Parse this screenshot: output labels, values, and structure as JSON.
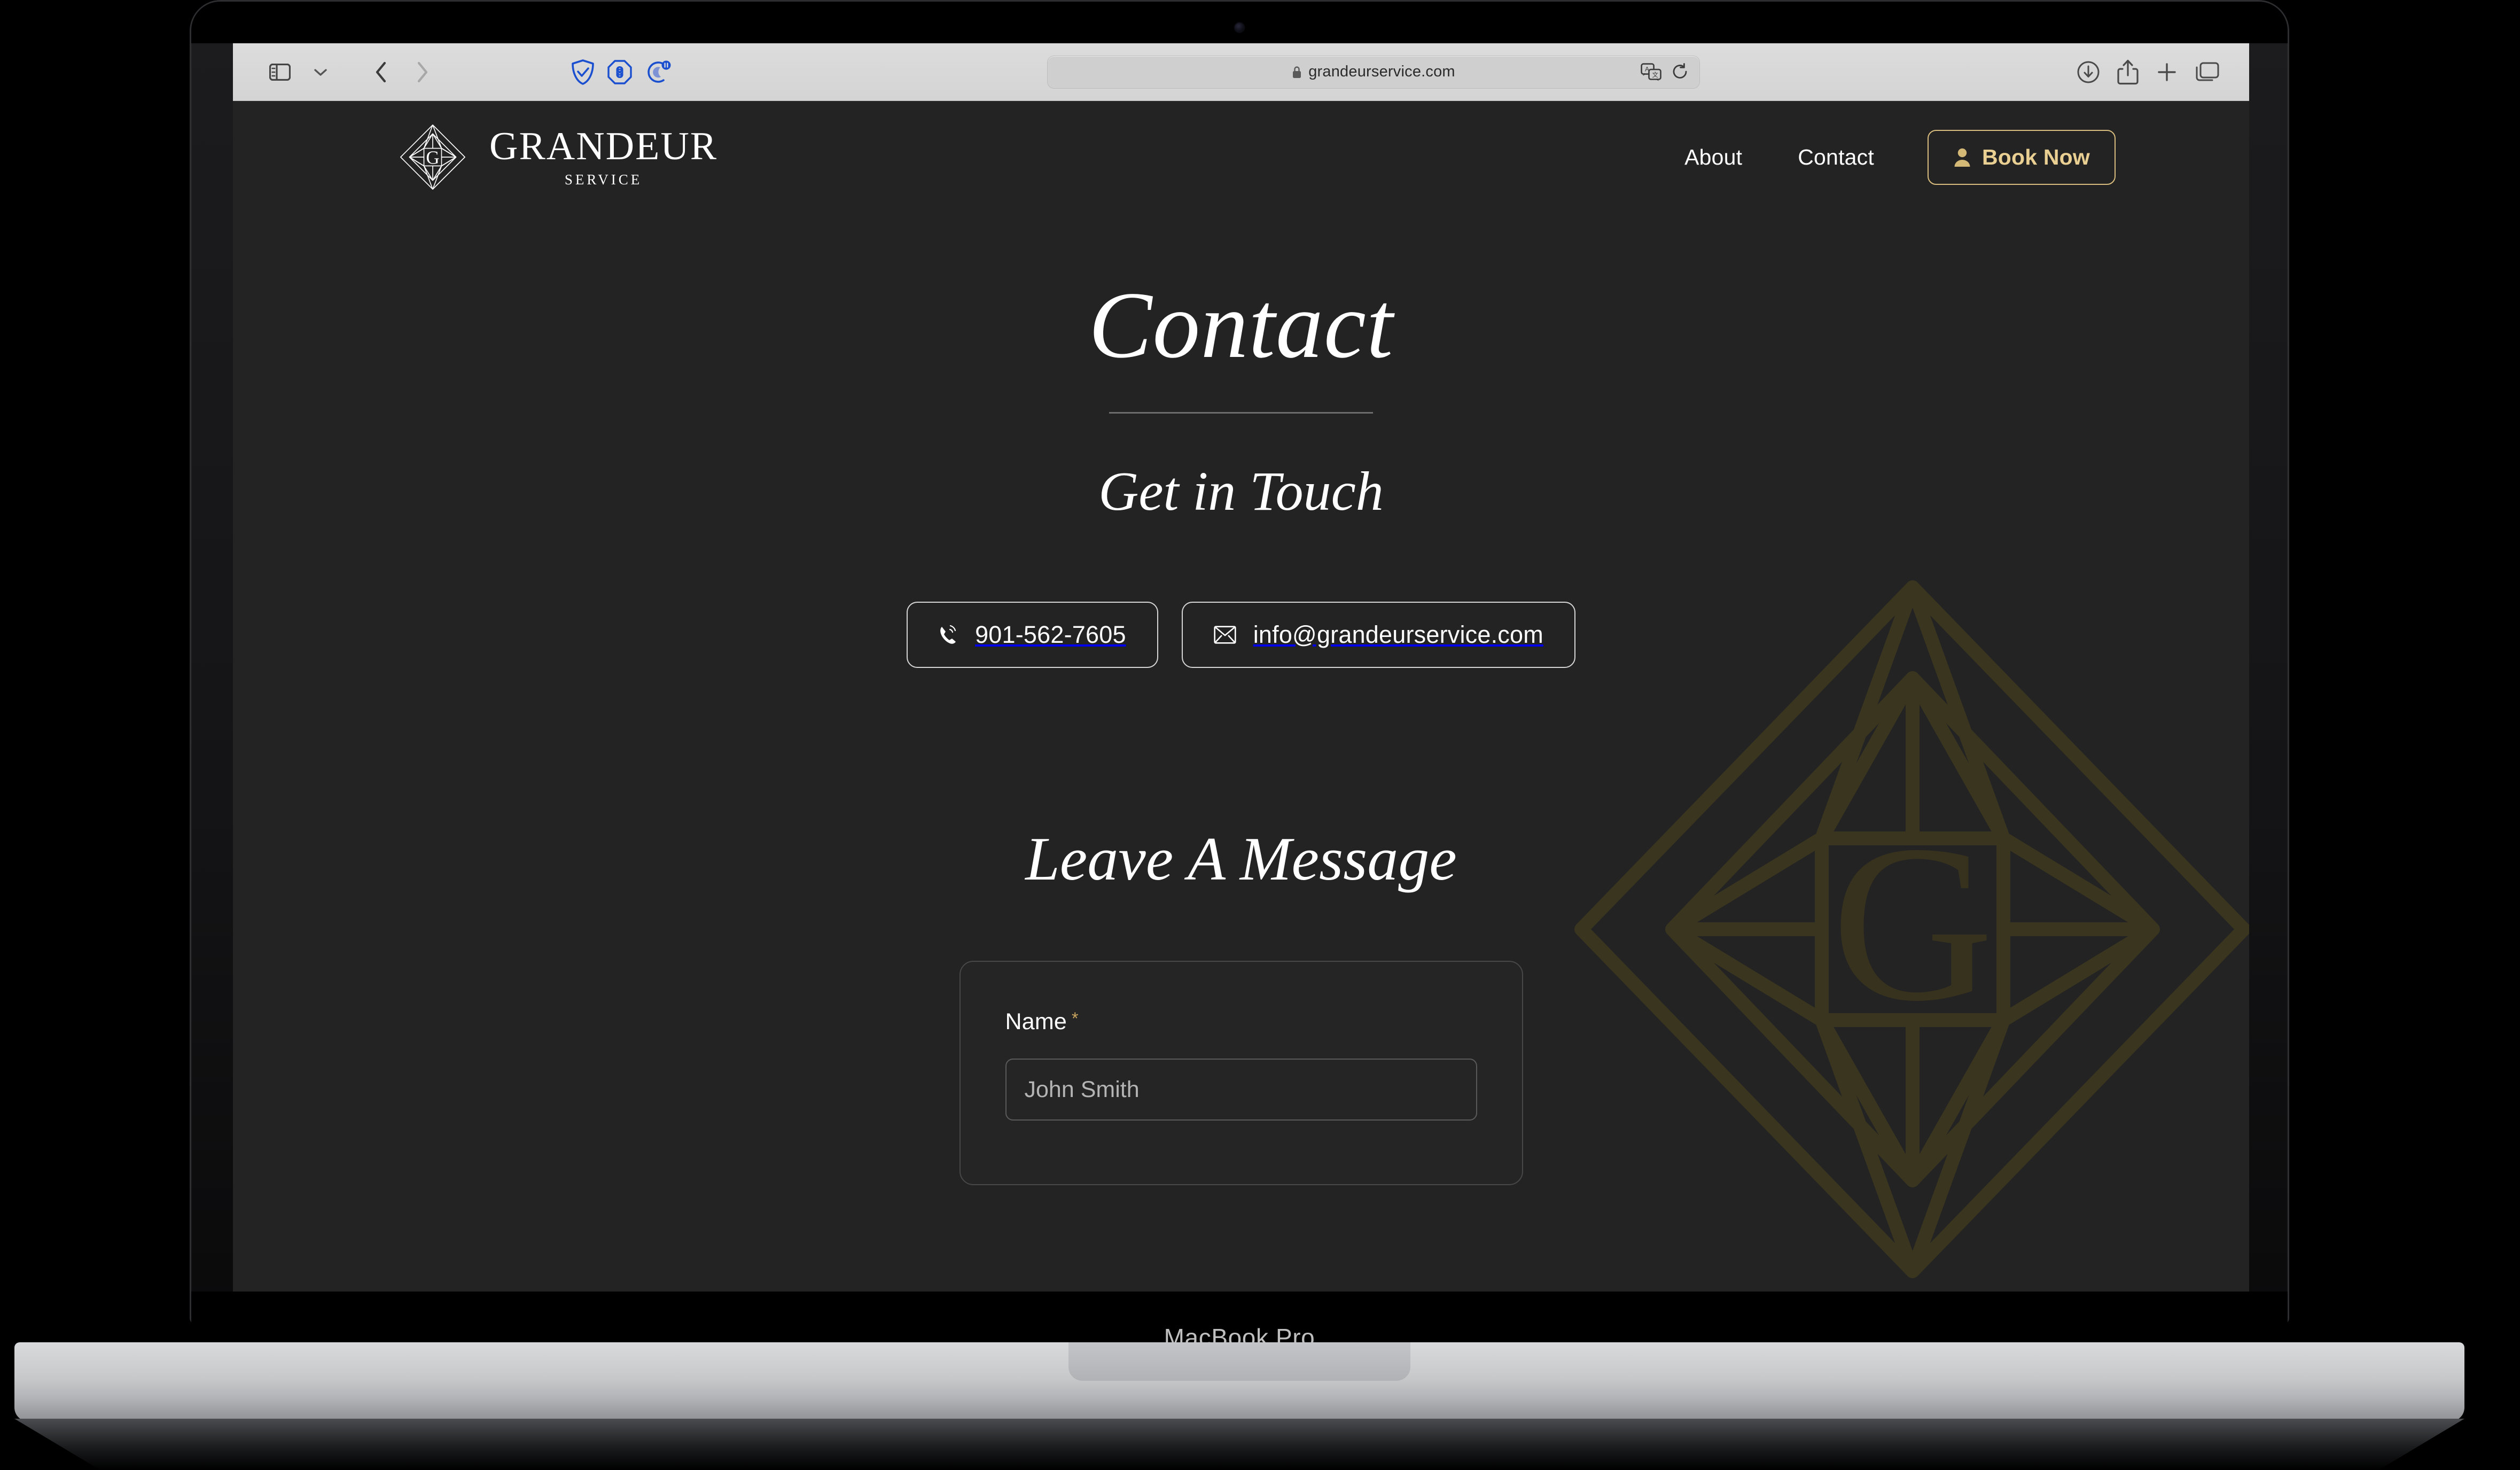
{
  "device": {
    "label": "MacBook Pro",
    "camera_icon": "camera-dot"
  },
  "browser": {
    "left_controls": [
      {
        "name": "sidebar-toggle",
        "icon": "sidebar-icon"
      },
      {
        "name": "sidebar-dropdown",
        "icon": "chevron-down-icon"
      },
      {
        "name": "back",
        "icon": "chevron-left-icon"
      },
      {
        "name": "forward",
        "icon": "chevron-right-icon"
      }
    ],
    "extensions": [
      {
        "name": "shield-check",
        "icon": "shield-check-icon",
        "color": "#1a4fcf"
      },
      {
        "name": "command-octagon",
        "icon": "command-octagon-icon",
        "color": "#1a4fcf"
      },
      {
        "name": "moon-pause",
        "icon": "moon-pause-icon",
        "color": "#1a4fcf"
      }
    ],
    "address_bar": {
      "lock_icon": "lock-icon",
      "url": "grandeurservice.com",
      "translate_icon": "translate-icon",
      "reload_icon": "reload-icon"
    },
    "right_controls": [
      {
        "name": "downloads",
        "icon": "download-circle-icon"
      },
      {
        "name": "share",
        "icon": "share-icon"
      },
      {
        "name": "new-tab",
        "icon": "plus-icon"
      },
      {
        "name": "tab-overview",
        "icon": "tabs-icon"
      }
    ]
  },
  "site": {
    "brand": {
      "name": "GRANDEUR",
      "tagline": "SERVICE",
      "logo_icon": "diamond-g-logo"
    },
    "nav": {
      "links": [
        {
          "label": "About"
        },
        {
          "label": "Contact"
        }
      ],
      "cta": {
        "label": "Book Now",
        "icon": "user-icon",
        "color": "#e9cf92",
        "border_color": "#d9bd7e"
      }
    },
    "hero": {
      "title": "Contact",
      "subtitle": "Get in Touch"
    },
    "contact_methods": [
      {
        "label": "901-562-7605",
        "icon": "phone-icon"
      },
      {
        "label": "info@grandeurservice.com",
        "icon": "envelope-icon"
      }
    ],
    "message_section": {
      "title": "Leave A Message",
      "fields": [
        {
          "label": "Name",
          "required_marker": "*",
          "placeholder": "John Smith",
          "value": ""
        }
      ]
    },
    "watermark": {
      "icon": "diamond-g-watermark",
      "letter": "G",
      "color": "#39341f"
    },
    "colors": {
      "background": "#232323",
      "text": "#ffffff",
      "accent_gold": "#e9cf92",
      "muted_border": "#5a5a5a"
    }
  }
}
